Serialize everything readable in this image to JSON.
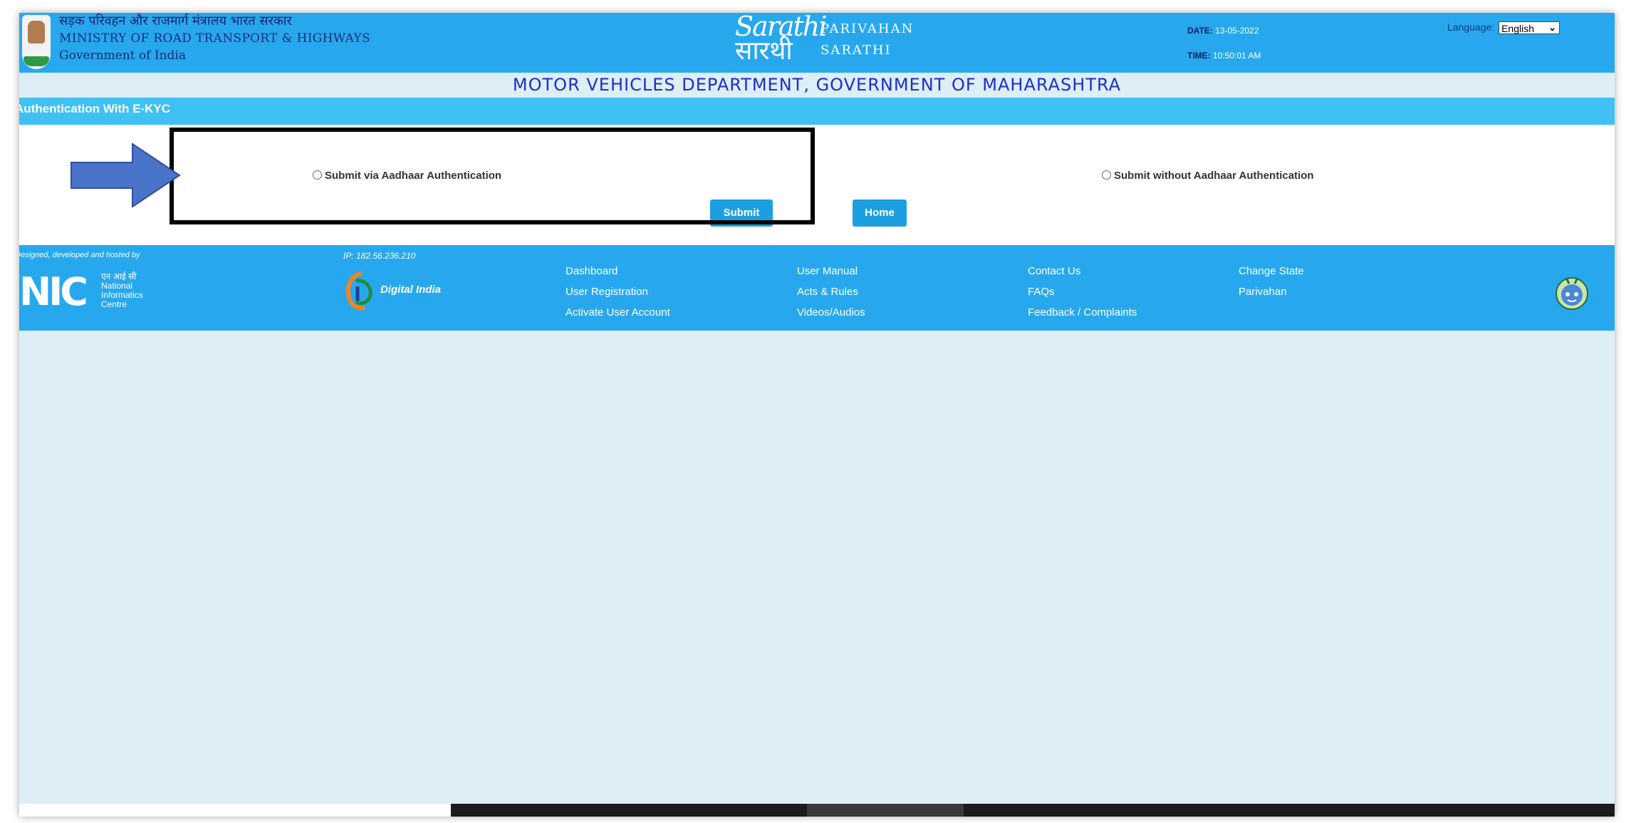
{
  "header": {
    "ministry_hindi": "सड़क परिवहन और राजमार्ग मंत्रालय भारत सरकार",
    "ministry_english": "MINISTRY OF ROAD TRANSPORT & HIGHWAYS",
    "government": "Government of India",
    "logo_script_1": "Sarathi",
    "logo_script_2": "सारथी",
    "brand_line1": "PARIVAHAN",
    "brand_line2": "SARATHI",
    "date_label": "DATE:",
    "date_value": "13-05-2022",
    "time_label": "TIME:",
    "time_value": "10:50:01 AM",
    "language_label": "Language:",
    "language_value": "English"
  },
  "department": {
    "title": "MOTOR VEHICLES DEPARTMENT, GOVERNMENT OF MAHARASHTRA"
  },
  "section": {
    "title": "Authentication With E-KYC"
  },
  "form": {
    "option_aadhaar": "Submit via Aadhaar Authentication",
    "option_without_aadhaar": "Submit without Aadhaar Authentication",
    "submit_label": "Submit",
    "home_label": "Home"
  },
  "footer": {
    "designed_by": "Designed, developed and hosted by",
    "nic_hindi": "एन आई सी",
    "nic_line1": "National",
    "nic_line2": "Informatics",
    "nic_line3": "Centre",
    "ip_label": "IP: 182.56.236.210",
    "digital_india": "Digital India",
    "col1": [
      "Dashboard",
      "User Registration",
      "Activate User Account"
    ],
    "col2": [
      "User Manual",
      "Acts & Rules",
      "Videos/Audios"
    ],
    "col3": [
      "Contact Us",
      "FAQs",
      "Feedback / Complaints"
    ],
    "col4": [
      "Change State",
      "Parivahan"
    ]
  },
  "colors": {
    "header_blue": "#27a8ee",
    "section_blue": "#3fc1f4",
    "dept_title": "#1f2dc9",
    "button_blue": "#1a9fe0",
    "page_bg": "#ddeef7"
  }
}
